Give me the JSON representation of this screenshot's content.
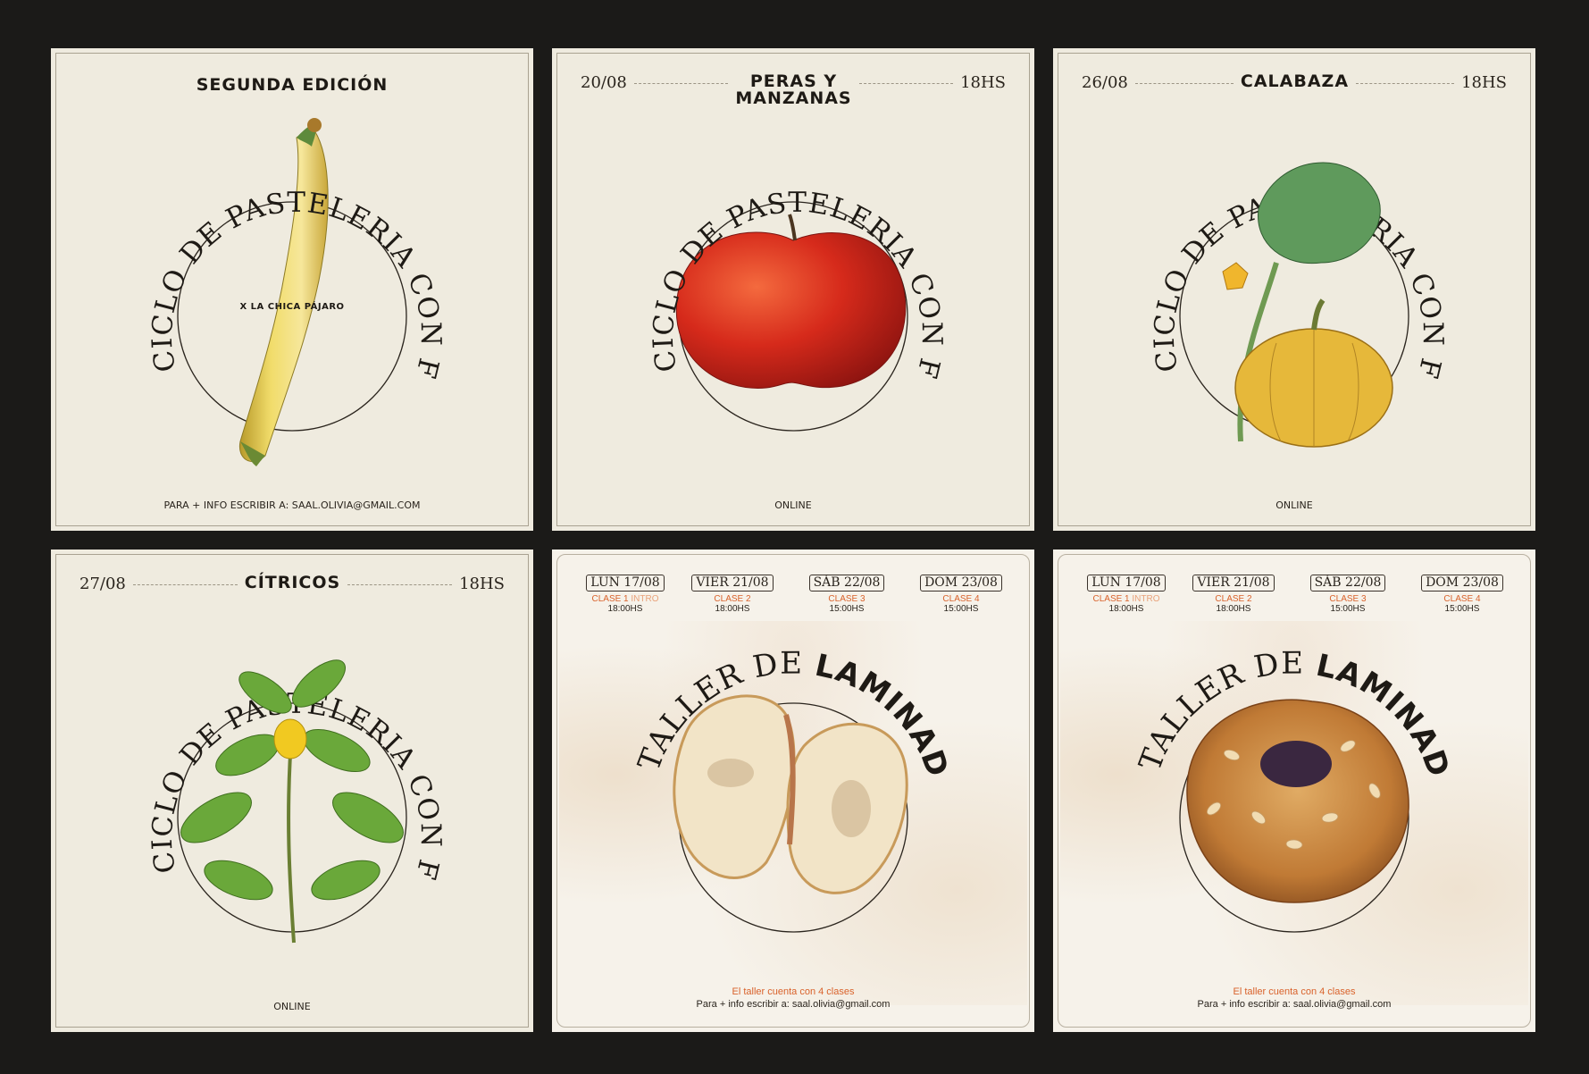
{
  "colors": {
    "background": "#1b1a18",
    "card": "#efebdf",
    "accent": "#d9622b",
    "ink": "#1e1a15"
  },
  "arc_text": "CICLO DE PASTELERIA CON FRUTXS",
  "cards": [
    {
      "title": "SEGUNDA EDICIÓN",
      "badge": "X LA CHICA PÁJARO",
      "footer": "PARA + INFO ESCRIBIR A: SAAL.OLIVIA@GMAIL.COM",
      "illustration": "banana"
    },
    {
      "date": "20/08",
      "title_line1": "PERAS Y",
      "title_line2": "MANZANAS",
      "time": "18HS",
      "footer": "ONLINE",
      "illustration": "apple"
    },
    {
      "date": "26/08",
      "title": "CALABAZA",
      "time": "18HS",
      "footer": "ONLINE",
      "illustration": "pumpkin"
    },
    {
      "date": "27/08",
      "title": "CÍTRICOS",
      "time": "18HS",
      "footer": "ONLINE",
      "illustration": "lemon-branch"
    }
  ],
  "workshop": {
    "arc_light": "TALLER DE ",
    "arc_bold": "LAMINADOS",
    "schedule": [
      {
        "day": "LUN 17/08",
        "clase": "CLASE 1",
        "intro": " INTRO",
        "hora": "18:00HS"
      },
      {
        "day": "VIER 21/08",
        "clase": "CLASE 2",
        "intro": "",
        "hora": "18:00HS"
      },
      {
        "day": "SÁB 22/08",
        "clase": "CLASE 3",
        "intro": "",
        "hora": "15:00HS"
      },
      {
        "day": "DOM 23/08",
        "clase": "CLASE 4",
        "intro": "",
        "hora": "15:00HS"
      }
    ],
    "footer_line1": "El taller cuenta con 4 clases",
    "footer_line2": "Para + info escribir a: saal.olivia@gmail.com"
  }
}
